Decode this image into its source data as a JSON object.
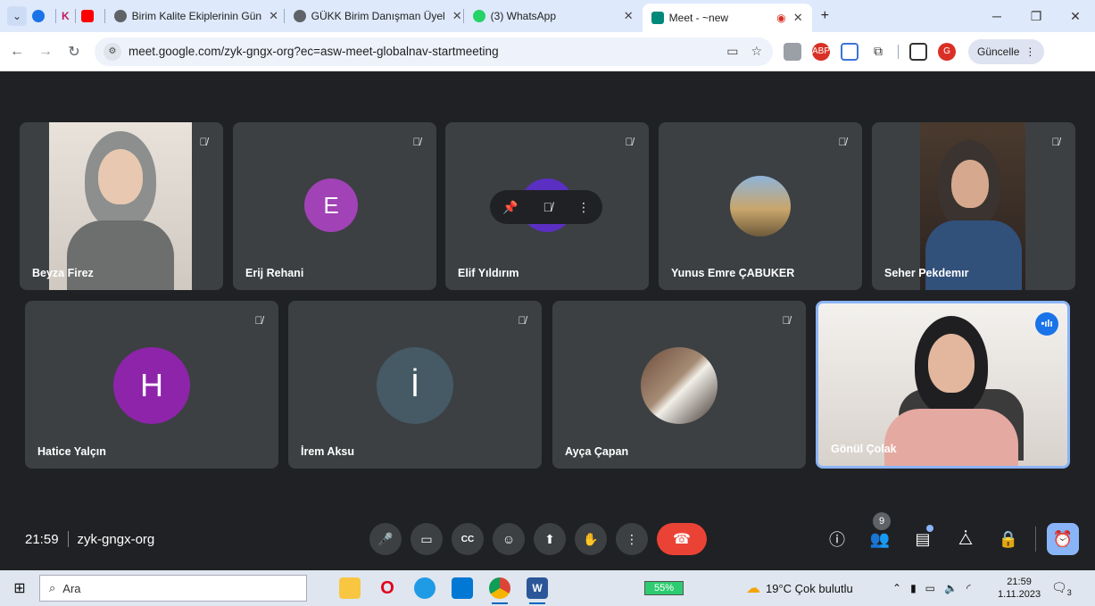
{
  "browser": {
    "tabs": [
      {
        "label": "Birim Kalite Ekiplerinin Gün",
        "icon": "globe-icon"
      },
      {
        "label": "GÜKK Birim Danışman Üyel",
        "icon": "globe-icon"
      },
      {
        "label": "(3) WhatsApp",
        "icon": "whatsapp-icon"
      },
      {
        "label": "Meet - ~new",
        "icon": "meet-icon"
      }
    ],
    "url": "meet.google.com/zyk-gngx-org?ec=asw-meet-globalnav-startmeeting",
    "update_label": "Güncelle",
    "profile_initial": "G",
    "abp_label": "ABP"
  },
  "meeting": {
    "participants_row1": [
      {
        "name": "Beyza Firez",
        "type": "video"
      },
      {
        "name": "Erij Rehani",
        "type": "initial",
        "initial": "E",
        "color": "#a142b6"
      },
      {
        "name": "Elif Yıldırım",
        "type": "initial",
        "initial": "",
        "color": "#5b2fc2"
      },
      {
        "name": "Yunus Emre ÇABUKER",
        "type": "photo"
      },
      {
        "name": "Seher Pekdemır",
        "type": "video"
      }
    ],
    "participants_row2": [
      {
        "name": "Hatice Yalçın",
        "type": "initial",
        "initial": "H",
        "color": "#8e24aa"
      },
      {
        "name": "İrem Aksu",
        "type": "initial",
        "initial": "İ",
        "color": "#455a64"
      },
      {
        "name": "Ayça Çapan",
        "type": "photo"
      },
      {
        "name": "Gönül Çolak",
        "type": "video"
      }
    ],
    "time": "21:59",
    "code": "zyk-gngx-org",
    "people_count": "9"
  },
  "taskbar": {
    "search_placeholder": "Ara",
    "battery": "55%",
    "weather": "19°C  Çok bulutlu",
    "clock_time": "21:59",
    "clock_date": "1.11.2023",
    "notif_count": "3"
  }
}
